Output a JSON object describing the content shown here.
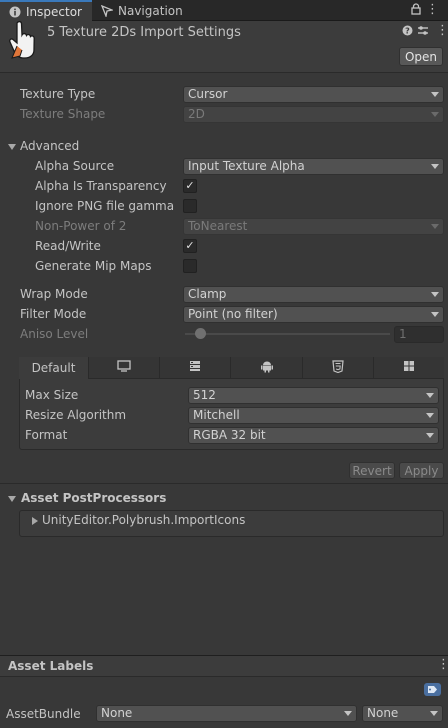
{
  "tabs": {
    "inspector": "Inspector",
    "navigation": "Navigation"
  },
  "header": {
    "title": "5 Texture 2Ds Import Settings",
    "open_button": "Open"
  },
  "fields": {
    "texture_type": {
      "label": "Texture Type",
      "value": "Cursor"
    },
    "texture_shape": {
      "label": "Texture Shape",
      "value": "2D"
    },
    "advanced": "Advanced",
    "alpha_source": {
      "label": "Alpha Source",
      "value": "Input Texture Alpha"
    },
    "alpha_is_transparency": {
      "label": "Alpha Is Transparency",
      "checked": true
    },
    "ignore_png_gamma": {
      "label": "Ignore PNG file gamma",
      "checked": false
    },
    "non_power_of_2": {
      "label": "Non-Power of 2",
      "value": "ToNearest"
    },
    "read_write": {
      "label": "Read/Write",
      "checked": true
    },
    "generate_mip_maps": {
      "label": "Generate Mip Maps",
      "checked": false
    },
    "wrap_mode": {
      "label": "Wrap Mode",
      "value": "Clamp"
    },
    "filter_mode": {
      "label": "Filter Mode",
      "value": "Point (no filter)"
    },
    "aniso_level": {
      "label": "Aniso Level",
      "value": "1"
    }
  },
  "platform": {
    "default_tab": "Default",
    "tab_icons": [
      "monitor-icon",
      "server-icon",
      "android-icon",
      "html5-icon",
      "windows-icon"
    ],
    "max_size": {
      "label": "Max Size",
      "value": "512"
    },
    "resize_algorithm": {
      "label": "Resize Algorithm",
      "value": "Mitchell"
    },
    "format": {
      "label": "Format",
      "value": "RGBA 32 bit"
    }
  },
  "buttons": {
    "revert": "Revert",
    "apply": "Apply"
  },
  "postprocessors": {
    "title": "Asset PostProcessors",
    "item": "UnityEditor.Polybrush.ImportIcons"
  },
  "footer": {
    "asset_labels": "Asset Labels",
    "asset_bundle_label": "AssetBundle",
    "asset_bundle_value": "None",
    "variant_value": "None"
  },
  "colors": {
    "accent": "#3a79bb",
    "background": "#383838"
  }
}
